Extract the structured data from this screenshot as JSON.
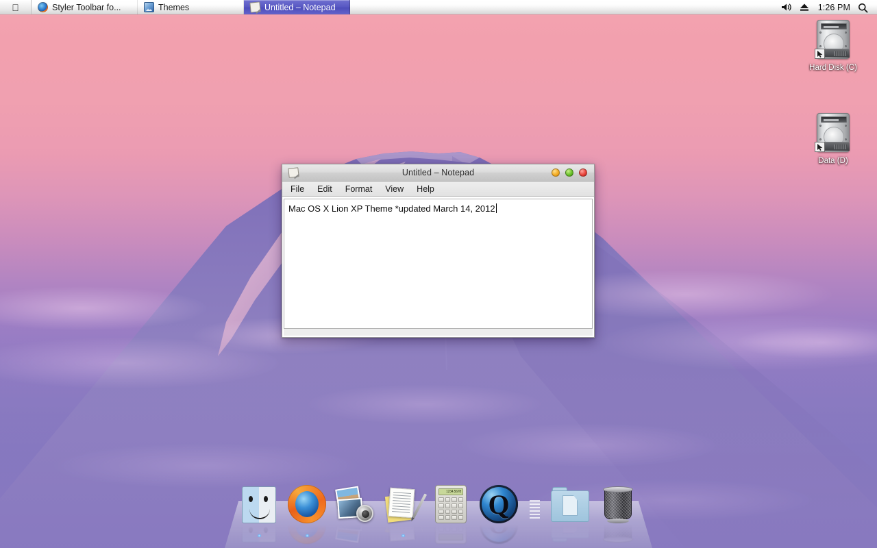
{
  "menubar": {
    "apple_icon": "apple-logo-icon",
    "tasks": [
      {
        "label": "Styler Toolbar fo...",
        "icon": "firefox-icon",
        "active": false
      },
      {
        "label": "Themes",
        "icon": "themes-icon",
        "active": false
      },
      {
        "label": "Untitled – Notepad",
        "icon": "notepad-icon",
        "active": true
      }
    ],
    "status": {
      "volume_icon": "volume-icon",
      "eject_icon": "eject-icon",
      "clock": "1:26 PM",
      "search_icon": "search-icon"
    },
    "active_bg": "#5a5ac4"
  },
  "desktop": {
    "icons": [
      {
        "label": "Hard Disk (C)",
        "icon": "hard-disk-icon",
        "shortcut": true
      },
      {
        "label": "Data (D)",
        "icon": "hard-disk-icon",
        "shortcut": true
      }
    ]
  },
  "notepad": {
    "title": "Untitled – Notepad",
    "icon": "notepad-icon",
    "buttons": {
      "minimize": "minimize-button",
      "maximize": "maximize-button",
      "close": "close-button",
      "minimize_color": "#f5ad25",
      "maximize_color": "#6cc22c",
      "close_color": "#e8453c"
    },
    "menu": [
      "File",
      "Edit",
      "Format",
      "View",
      "Help"
    ],
    "content": "Mac OS X Lion XP Theme *updated March 14, 2012"
  },
  "dock": {
    "items": [
      {
        "name": "finder",
        "label": "Finder",
        "running": true
      },
      {
        "name": "firefox",
        "label": "Firefox",
        "running": true
      },
      {
        "name": "photos",
        "label": "iPhoto",
        "running": false
      },
      {
        "name": "notes",
        "label": "TextEdit",
        "running": true
      },
      {
        "name": "calculator",
        "label": "Calculator",
        "running": false
      },
      {
        "name": "quicktime",
        "label": "QuickTime",
        "running": false
      },
      {
        "name": "separator",
        "label": "Separator",
        "running": false
      },
      {
        "name": "documents",
        "label": "Documents",
        "running": false
      },
      {
        "name": "trash",
        "label": "Trash",
        "running": false
      }
    ],
    "calculator_display": "1234.5678"
  },
  "wallpaper": {
    "name": "Mount Fuji at dawn",
    "sky_top": "#f4a3b0",
    "sky_bottom": "#7d72bf",
    "mountain": "#8a7bbd"
  }
}
